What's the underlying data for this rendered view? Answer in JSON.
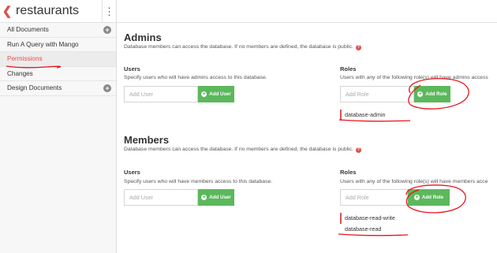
{
  "header": {
    "db_name": "restaurants"
  },
  "sidebar": {
    "items": [
      {
        "label": "All Documents",
        "has_add": true
      },
      {
        "label": "Run A Query with Mango",
        "has_add": false
      },
      {
        "label": "Permissions",
        "has_add": false,
        "active": true
      },
      {
        "label": "Changes",
        "has_add": false
      },
      {
        "label": "Design Documents",
        "has_add": true
      }
    ]
  },
  "admins": {
    "title": "Admins",
    "description": "Database members can access the database. If no members are defined, the database is public.",
    "users": {
      "label": "Users",
      "description": "Specify users who will have admins access to this database.",
      "placeholder": "Add User",
      "button": "Add User"
    },
    "roles": {
      "label": "Roles",
      "description": "Users with any of the following role(s) will have admins access",
      "placeholder": "Add Role",
      "button": "Add Role",
      "items": [
        "database-admin"
      ]
    }
  },
  "members": {
    "title": "Members",
    "description": "Database members can access the database. If no members are defined, the database is public.",
    "users": {
      "label": "Users",
      "description": "Specify users who will have members access to this database.",
      "placeholder": "Add User",
      "button": "Add User"
    },
    "roles": {
      "label": "Roles",
      "description": "Users with any of the following role(s) will have members acce",
      "placeholder": "Add Role",
      "button": "Add Role",
      "items": [
        "database-read-write",
        "database-read"
      ]
    }
  },
  "colors": {
    "accent": "#d9534f",
    "button": "#5cb85c",
    "annotation": "#e8151b"
  }
}
